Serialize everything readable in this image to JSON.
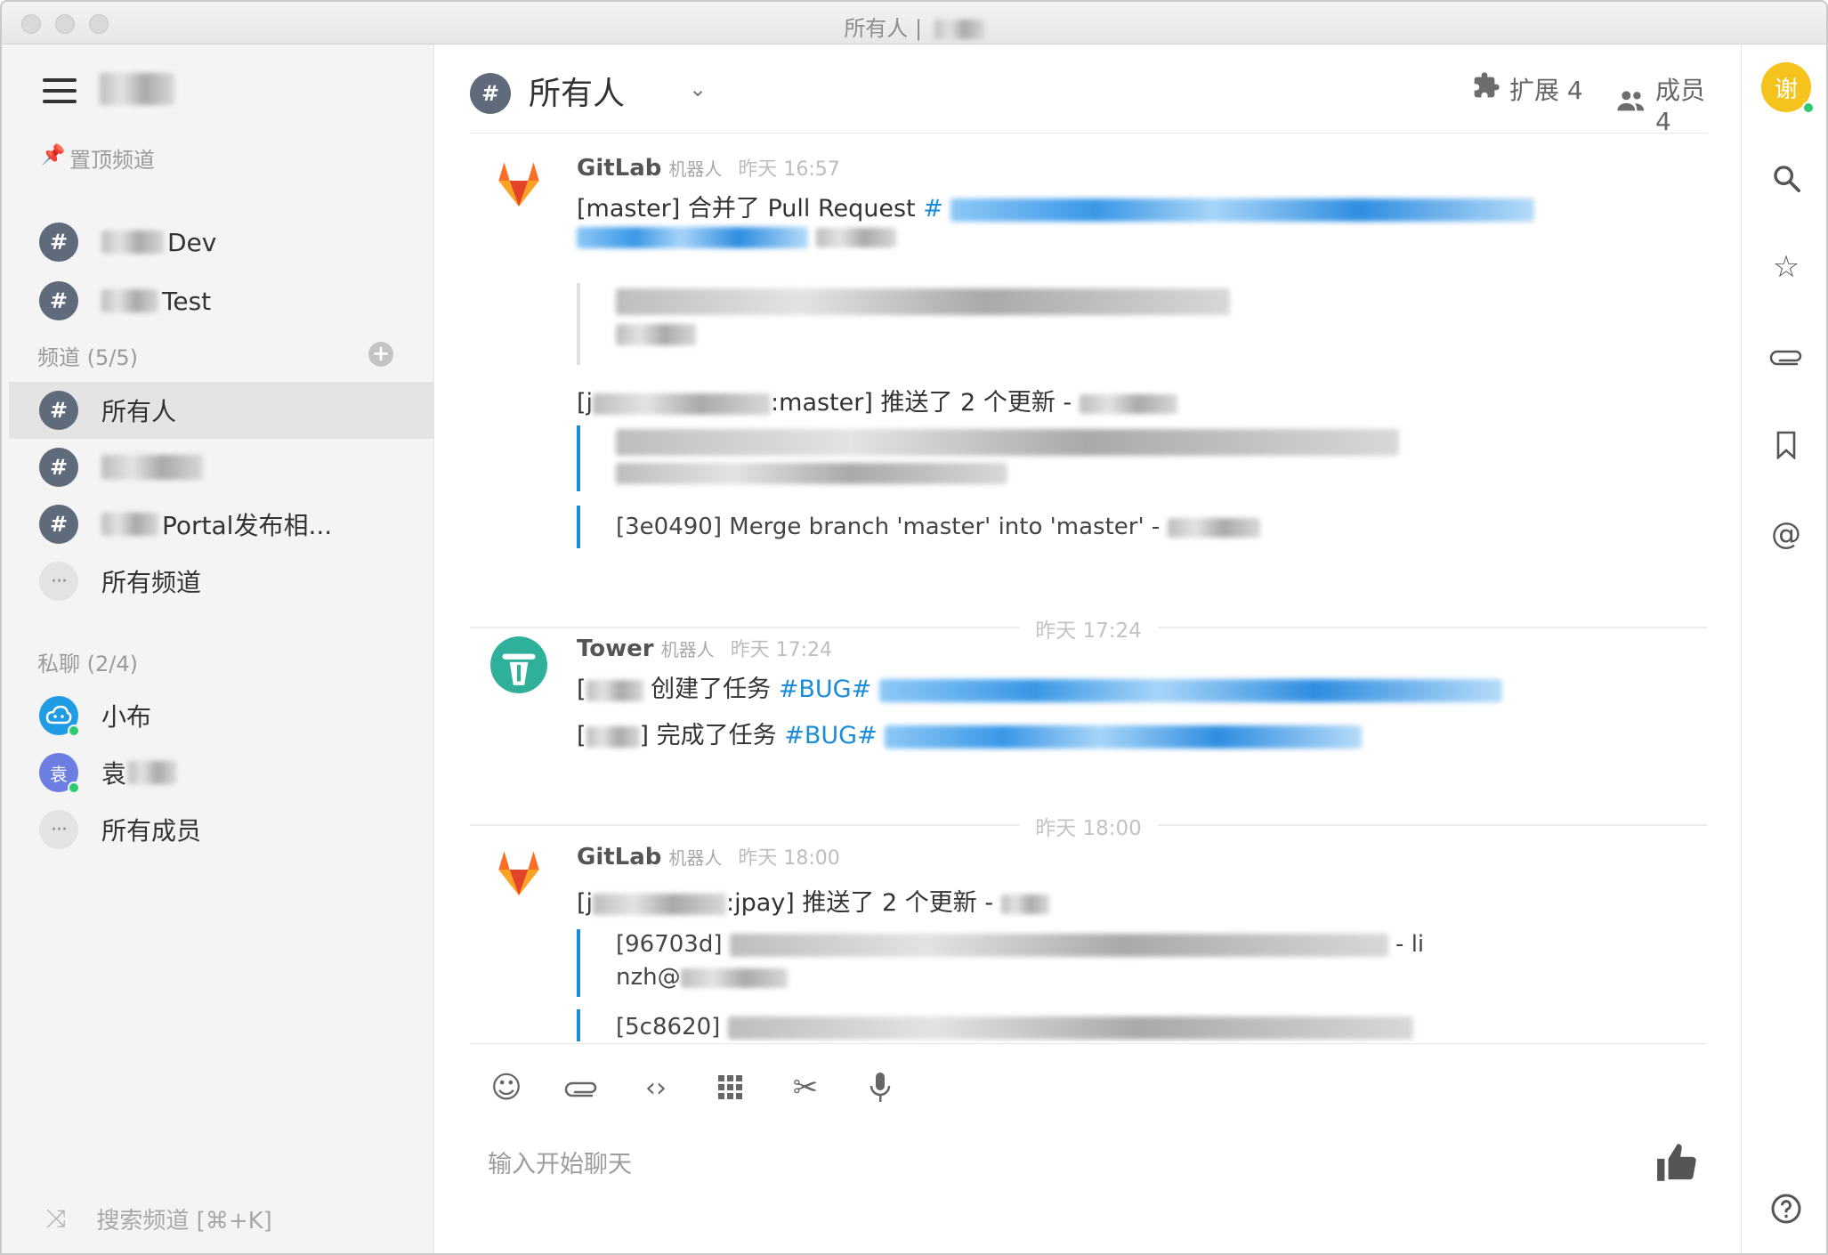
{
  "window": {
    "title": "所有人 |"
  },
  "sidebar": {
    "pinned_label": "置顶频道",
    "pinned": [
      {
        "label": "Dev"
      },
      {
        "label": "Test"
      }
    ],
    "channels_label": "频道 (5/5)",
    "channels": [
      {
        "label": "所有人"
      },
      {
        "label": ""
      },
      {
        "label": "Portal发布相..."
      }
    ],
    "all_channels": "所有频道",
    "dm_label": "私聊 (2/4)",
    "dms": [
      {
        "label": "小布",
        "avatar_color": "#1f9ce4"
      },
      {
        "label": "袁",
        "avatar_text": "袁",
        "avatar_color": "#6c7ee1"
      }
    ],
    "all_members": "所有成员",
    "search_label": "搜索频道 [⌘+K]"
  },
  "header": {
    "channel": "所有人",
    "extensions": "扩展 4",
    "members": "成员 4"
  },
  "messages": [
    {
      "sender": "GitLab",
      "role": "机器人",
      "time": "昨天 16:57",
      "line1_prefix": "[master] 合并了 Pull Request",
      "line1_tag": "#",
      "push_line": ":master] 推送了 2 个更新 -",
      "push_line_prefix": "[j",
      "commit2": "[3e0490] Merge branch 'master' into 'master' -"
    },
    {
      "divider": "昨天 17:24"
    },
    {
      "sender": "Tower",
      "role": "机器人",
      "time": "昨天 17:24",
      "line1_prefix": "[",
      "line1_mid": "创建了任务",
      "line1_tag": "#BUG#",
      "line2_prefix": "[",
      "line2_mid": "] 完成了任务",
      "line2_tag": "#BUG#"
    },
    {
      "divider": "昨天 18:00"
    },
    {
      "sender": "GitLab",
      "role": "机器人",
      "time": "昨天 18:00",
      "push_line_prefix": "[j",
      "push_line": ":jpay] 推送了 2 个更新 -",
      "commit1_id": "[96703d]",
      "commit1_tail": "- li",
      "commit1_line2": "nzh@",
      "commit2_id": "[5c8620]"
    }
  ],
  "composer": {
    "placeholder": "输入开始聊天",
    "tools": [
      "emoji-icon",
      "attachment-icon",
      "code-icon",
      "apps-icon",
      "scissors-icon",
      "microphone-icon"
    ]
  },
  "rail": {
    "avatar_text": "谢",
    "avatar_color": "#f6c21c",
    "icons": [
      "search-icon",
      "star-icon",
      "attachment-icon",
      "bookmark-icon",
      "at-icon",
      "help-icon"
    ]
  },
  "colors": {
    "accent": "#1a8cd8",
    "hash_badge": "#5f6b7a",
    "online": "#2ecc71",
    "sidebar_bg": "#f4f4f4"
  }
}
